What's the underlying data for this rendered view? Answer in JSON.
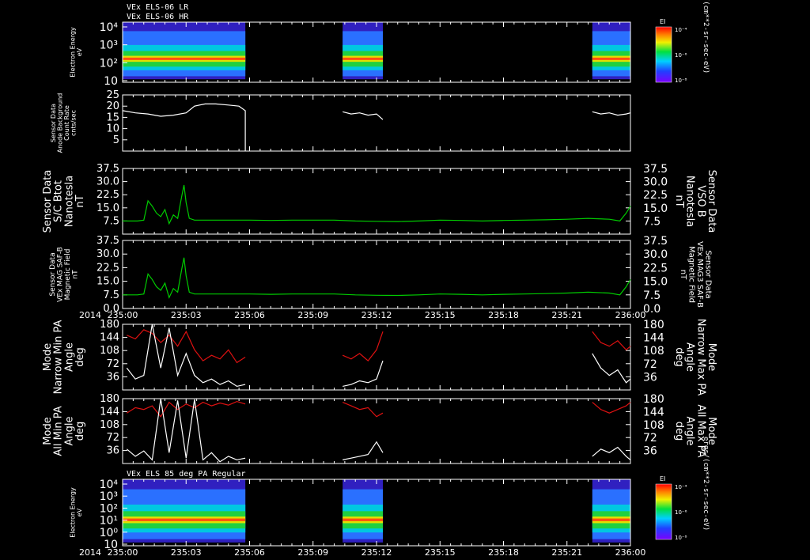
{
  "header": {
    "line1": "VEx ELS-06 LR",
    "line2": "VEx ELS-06 HR"
  },
  "colors": {
    "white": "#ffffff",
    "green": "#00cc00",
    "red": "#dd1111",
    "background": "#000000"
  },
  "year_label": "2014",
  "chart_data": [
    {
      "type": "heatmap",
      "name": "electron-spectrogram-top",
      "ylabel": [
        "Electron Energy",
        "eV"
      ],
      "yscale": "log",
      "ylim": [
        1,
        10000
      ],
      "yticks": [
        "10⁴",
        "10³",
        "10²",
        "10"
      ],
      "colorbar": {
        "title": "EI",
        "ticks": [
          "10⁻⁴",
          "10⁻⁶",
          "10⁻⁸"
        ]
      },
      "units_label": "ergs/(cm**2-sr-sec-eV)",
      "data_intervals_min": [
        [
          0,
          5.8
        ],
        [
          10.4,
          12.3
        ],
        [
          22.2,
          24.0
        ]
      ]
    },
    {
      "type": "line",
      "name": "anode-background",
      "ylabel": [
        "Sensor Data",
        "Anode Background",
        "Count Rate",
        "cnts/sec"
      ],
      "ylim": [
        0,
        25
      ],
      "yticks": [
        "25",
        "20",
        "15",
        "10",
        "5"
      ],
      "series": [
        {
          "color": "#ffffff",
          "segments": [
            {
              "x": [
                0,
                0.6,
                1.2,
                1.8,
                2.4,
                3.0,
                3.4,
                3.9,
                4.4,
                5.0,
                5.5,
                5.8,
                5.8
              ],
              "y": [
                18,
                17,
                16.5,
                15.5,
                16,
                17,
                20,
                21,
                21,
                20.5,
                20,
                18,
                0
              ]
            },
            {
              "x": [
                10.4,
                10.8,
                11.2,
                11.6,
                12.0,
                12.3
              ],
              "y": [
                17.5,
                16.5,
                17,
                16,
                16.5,
                14
              ]
            },
            {
              "x": [
                22.2,
                22.6,
                23.0,
                23.4,
                23.8,
                24.0
              ],
              "y": [
                17.5,
                16.5,
                17,
                16,
                16.5,
                17
              ]
            }
          ]
        }
      ]
    },
    {
      "type": "line",
      "name": "sc-btot",
      "ylabel": [
        "Sensor Data",
        "S/C Btot",
        "Nanotesla",
        "nT"
      ],
      "ylabel_right": [
        "Sensor Data",
        "VSO B",
        "Nanotesla",
        "nT"
      ],
      "ylim": [
        0,
        37.5
      ],
      "yticks": [
        "37.5",
        "30.0",
        "22.5",
        "15.0",
        "7.5"
      ],
      "series": [
        {
          "color": "#00cc00",
          "x": [
            0,
            0.7,
            1.0,
            1.2,
            1.4,
            1.6,
            1.8,
            2.0,
            2.2,
            2.4,
            2.6,
            2.8,
            2.9,
            3.0,
            3.15,
            3.4,
            4,
            5,
            6,
            7,
            8,
            9,
            10,
            11,
            12,
            13,
            14,
            15,
            16,
            17,
            18,
            19,
            20,
            21,
            22,
            23,
            23.5,
            23.8,
            24
          ],
          "y": [
            7.5,
            7.5,
            8,
            19,
            16,
            12,
            10,
            14,
            6,
            11,
            9,
            22,
            28,
            18,
            9,
            8,
            8,
            8,
            8,
            7.8,
            8,
            8,
            8,
            7.5,
            7.3,
            7.2,
            7.5,
            8,
            7.8,
            7.5,
            7.8,
            8,
            8.2,
            8.5,
            9,
            8.5,
            7.5,
            12,
            16
          ]
        }
      ]
    },
    {
      "type": "line",
      "name": "mag-saf-b",
      "ylabel": [
        "Sensor Data",
        "VEx MAG SAF-B",
        "Magnetic Field",
        "nT"
      ],
      "ylabel_right": [
        "Sensor Data",
        "VEx MAG3 SAF-B",
        "Magnetic Field",
        "nT"
      ],
      "ylim": [
        0,
        37.5
      ],
      "yticks": [
        "37.5",
        "30.0",
        "22.5",
        "15.0",
        "7.5",
        "0.0"
      ],
      "series": [
        {
          "color": "#00cc00",
          "x": [
            0,
            0.7,
            1.0,
            1.2,
            1.4,
            1.6,
            1.8,
            2.0,
            2.2,
            2.4,
            2.6,
            2.8,
            2.9,
            3.0,
            3.15,
            3.4,
            4,
            5,
            6,
            7,
            8,
            9,
            10,
            11,
            12,
            13,
            14,
            15,
            16,
            17,
            18,
            19,
            20,
            21,
            22,
            23,
            23.5,
            23.8,
            24
          ],
          "y": [
            7.5,
            7.5,
            8,
            19,
            16,
            12,
            10,
            14,
            6,
            11,
            9,
            22,
            28,
            18,
            9,
            8,
            8,
            8,
            8,
            7.8,
            8,
            8,
            8,
            7.5,
            7.3,
            7.2,
            7.5,
            8,
            7.8,
            7.5,
            7.8,
            8,
            8.2,
            8.5,
            9,
            8.5,
            7.5,
            12,
            16
          ]
        }
      ]
    },
    {
      "type": "line",
      "name": "narrow-pa",
      "ylabel": [
        "Mode",
        "Narrow Min PA",
        "Angle",
        "deg"
      ],
      "ylabel_right": [
        "Mode",
        "Narrow Max PA",
        "Angle",
        "deg"
      ],
      "ylim": [
        0,
        180
      ],
      "yticks": [
        "180",
        "144",
        "108",
        "72",
        "36"
      ],
      "series": [
        {
          "color": "#dd1111",
          "segments": [
            {
              "x": [
                0.2,
                0.6,
                1.0,
                1.4,
                1.8,
                2.2,
                2.6,
                3.0,
                3.4,
                3.8,
                4.2,
                4.6,
                5.0,
                5.4,
                5.8
              ],
              "y": [
                150,
                140,
                165,
                155,
                130,
                150,
                120,
                160,
                110,
                80,
                95,
                85,
                110,
                75,
                90
              ]
            },
            {
              "x": [
                10.4,
                10.8,
                11.2,
                11.6,
                12.0,
                12.3
              ],
              "y": [
                95,
                85,
                100,
                80,
                110,
                160
              ]
            },
            {
              "x": [
                22.2,
                22.6,
                23.0,
                23.4,
                23.8,
                24.0
              ],
              "y": [
                160,
                130,
                120,
                135,
                110,
                120
              ]
            }
          ]
        },
        {
          "color": "#ffffff",
          "segments": [
            {
              "x": [
                0.2,
                0.6,
                1.0,
                1.4,
                1.8,
                2.2,
                2.6,
                3.0,
                3.4,
                3.8,
                4.2,
                4.6,
                5.0,
                5.4,
                5.8
              ],
              "y": [
                60,
                30,
                40,
                180,
                60,
                170,
                40,
                100,
                40,
                20,
                30,
                15,
                25,
                10,
                15
              ]
            },
            {
              "x": [
                10.4,
                10.8,
                11.2,
                11.6,
                12.0,
                12.3
              ],
              "y": [
                10,
                15,
                25,
                20,
                30,
                80
              ]
            },
            {
              "x": [
                22.2,
                22.6,
                23.0,
                23.4,
                23.8,
                24.0
              ],
              "y": [
                100,
                60,
                40,
                55,
                20,
                30
              ]
            }
          ]
        }
      ]
    },
    {
      "type": "line",
      "name": "all-pa",
      "ylabel": [
        "Mode",
        "All Min PA",
        "Angle",
        "deg"
      ],
      "ylabel_right": [
        "Mode",
        "All Max PA",
        "Angle",
        "deg"
      ],
      "ylim": [
        0,
        180
      ],
      "yticks": [
        "180",
        "144",
        "108",
        "72",
        "36"
      ],
      "series": [
        {
          "color": "#dd1111",
          "segments": [
            {
              "x": [
                0.2,
                0.6,
                1.0,
                1.4,
                1.8,
                2.2,
                2.6,
                3.0,
                3.4,
                3.8,
                4.2,
                4.6,
                5.0,
                5.4,
                5.8
              ],
              "y": [
                140,
                155,
                150,
                160,
                130,
                170,
                150,
                165,
                155,
                170,
                160,
                168,
                162,
                172,
                165
              ]
            },
            {
              "x": [
                10.4,
                10.8,
                11.2,
                11.6,
                12.0,
                12.3
              ],
              "y": [
                170,
                160,
                150,
                155,
                130,
                140
              ]
            },
            {
              "x": [
                22.2,
                22.6,
                23.0,
                23.4,
                23.8,
                24.0
              ],
              "y": [
                170,
                150,
                140,
                150,
                160,
                170
              ]
            }
          ]
        },
        {
          "color": "#ffffff",
          "segments": [
            {
              "x": [
                0.2,
                0.6,
                1.0,
                1.4,
                1.8,
                2.2,
                2.6,
                3.0,
                3.4,
                3.8,
                4.2,
                4.6,
                5.0,
                5.4,
                5.8
              ],
              "y": [
                40,
                20,
                35,
                10,
                180,
                30,
                175,
                15,
                178,
                10,
                30,
                5,
                20,
                10,
                15
              ]
            },
            {
              "x": [
                10.4,
                10.8,
                11.2,
                11.6,
                12.0,
                12.3
              ],
              "y": [
                10,
                15,
                20,
                25,
                60,
                30
              ]
            },
            {
              "x": [
                22.2,
                22.6,
                23.0,
                23.4,
                23.8,
                24.0
              ],
              "y": [
                20,
                40,
                30,
                45,
                20,
                10
              ]
            }
          ]
        }
      ]
    },
    {
      "type": "heatmap",
      "name": "electron-spectrogram-bottom",
      "title": "VEx ELS 85 deg PA Regular",
      "ylabel": [
        "Electron Energy",
        "eV"
      ],
      "yscale": "log",
      "ylim": [
        1,
        10000
      ],
      "yticks": [
        "10⁴",
        "10³",
        "10²",
        "10¹",
        "10⁰",
        "10"
      ],
      "colorbar": {
        "title": "EI",
        "ticks": [
          "10⁻⁴",
          "10⁻⁶",
          "10⁻⁸"
        ]
      },
      "units_label": "ergs/(cm**2-sr-sec-eV)",
      "data_intervals_min": [
        [
          0,
          5.8
        ],
        [
          10.4,
          12.3
        ],
        [
          22.2,
          24.0
        ]
      ]
    }
  ],
  "time_axis": {
    "range_min": [
      0,
      24
    ],
    "tick_labels": [
      "235:00",
      "235:03",
      "235:06",
      "235:09",
      "235:12",
      "235:15",
      "235:18",
      "235:21",
      "236:00"
    ]
  }
}
